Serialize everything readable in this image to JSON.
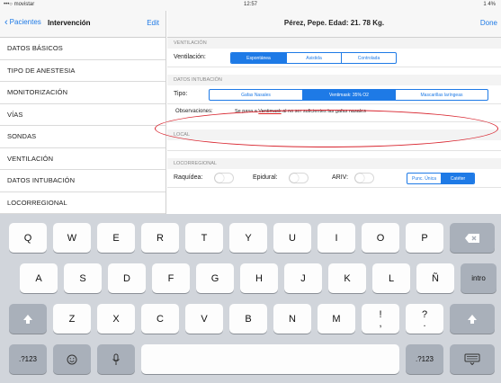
{
  "status": {
    "carrier": "•••○ movistar",
    "time": "12:57",
    "battery": "1 4%"
  },
  "sidebar": {
    "back_label": "Pacientes",
    "title": "Intervención",
    "edit_label": "Edit",
    "items": [
      {
        "label": "DATOS BÁSICOS"
      },
      {
        "label": "TIPO DE ANESTESIA"
      },
      {
        "label": "MONITORIZACIÓN"
      },
      {
        "label": "VÍAS"
      },
      {
        "label": "SONDAS"
      },
      {
        "label": "VENTILACIÓN"
      },
      {
        "label": "DATOS INTUBACIÓN"
      },
      {
        "label": "LOCORREGIONAL"
      }
    ]
  },
  "main": {
    "title": "Pérez, Pepe. Edad: 21. 78 Kg.",
    "done_label": "Done",
    "ventilacion": {
      "header": "VENTILACIÓN",
      "label": "Ventilación:",
      "options": [
        "Espontánea",
        "Asistida",
        "Controlada"
      ],
      "selected": 0
    },
    "intubacion": {
      "header": "DATOS INTUBACIÓN",
      "tipo_label": "Tipo:",
      "tipo_options": [
        "Gafas Nasales",
        "Ventimask: 35% O2",
        "Mascarillas laríngeas"
      ],
      "tipo_selected": 1,
      "obs_label": "Observaciones:",
      "obs_value_pre": "Se pasa a ",
      "obs_value_underlined": "Ventimask",
      "obs_value_post": " al no ser suficientes las gafas nasales"
    },
    "local_header": "LOCAL",
    "locorregional": {
      "header": "LOCORREGIONAL",
      "raquidea": "Raquídea:",
      "epidural": "Epidural:",
      "arv": "ARIV:",
      "options": [
        "Punc. Única",
        "Catéter"
      ],
      "selected": 1
    }
  },
  "keyboard": {
    "row1": [
      "Q",
      "W",
      "E",
      "R",
      "T",
      "Y",
      "U",
      "I",
      "O",
      "P"
    ],
    "row2": [
      "A",
      "S",
      "D",
      "F",
      "G",
      "H",
      "J",
      "K",
      "L",
      "Ñ"
    ],
    "row3": [
      "Z",
      "X",
      "C",
      "V",
      "B",
      "N",
      "M",
      "!",
      "?"
    ],
    "row3_sub": [
      ",",
      "."
    ],
    "intro": "intro",
    "num1": ".?123",
    "num2": ".?123",
    "delete_icon": "backspace-icon",
    "shift_icon": "shift-icon",
    "emoji_icon": "emoji-icon",
    "mic_icon": "microphone-icon",
    "hide_icon": "keyboard-hide-icon"
  }
}
